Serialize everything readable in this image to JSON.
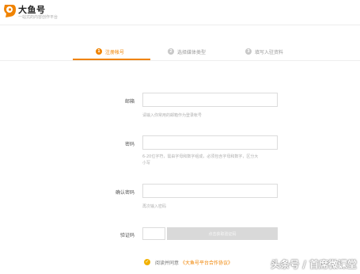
{
  "header": {
    "brand": "大鱼号",
    "tagline": "一站式的内容创作平台"
  },
  "steps": [
    {
      "num": "1",
      "label": "注册帐号",
      "active": true
    },
    {
      "num": "2",
      "label": "选择媒体类型",
      "active": false
    },
    {
      "num": "3",
      "label": "填写入驻资料",
      "active": false
    }
  ],
  "form": {
    "email_label": "邮箱",
    "email_hint": "请输入你常用的邮箱作为登录帐号",
    "password_label": "密码",
    "password_hint_1": "6-20位字符，需由字母和数字组成，必须包含字母和数字，区分大",
    "password_hint_2": "小写",
    "confirm_label": "确认密码",
    "confirm_hint": "再次输入密码",
    "captcha_label": "验证码",
    "captcha_button": "点击获取验证码"
  },
  "agreement": {
    "prefix": "阅读并同意",
    "link": "《大鱼号平台合作协议》"
  },
  "watermark": "头条号 / 首席微课堂",
  "colors": {
    "accent": "#f08300",
    "check": "#f2b100"
  }
}
